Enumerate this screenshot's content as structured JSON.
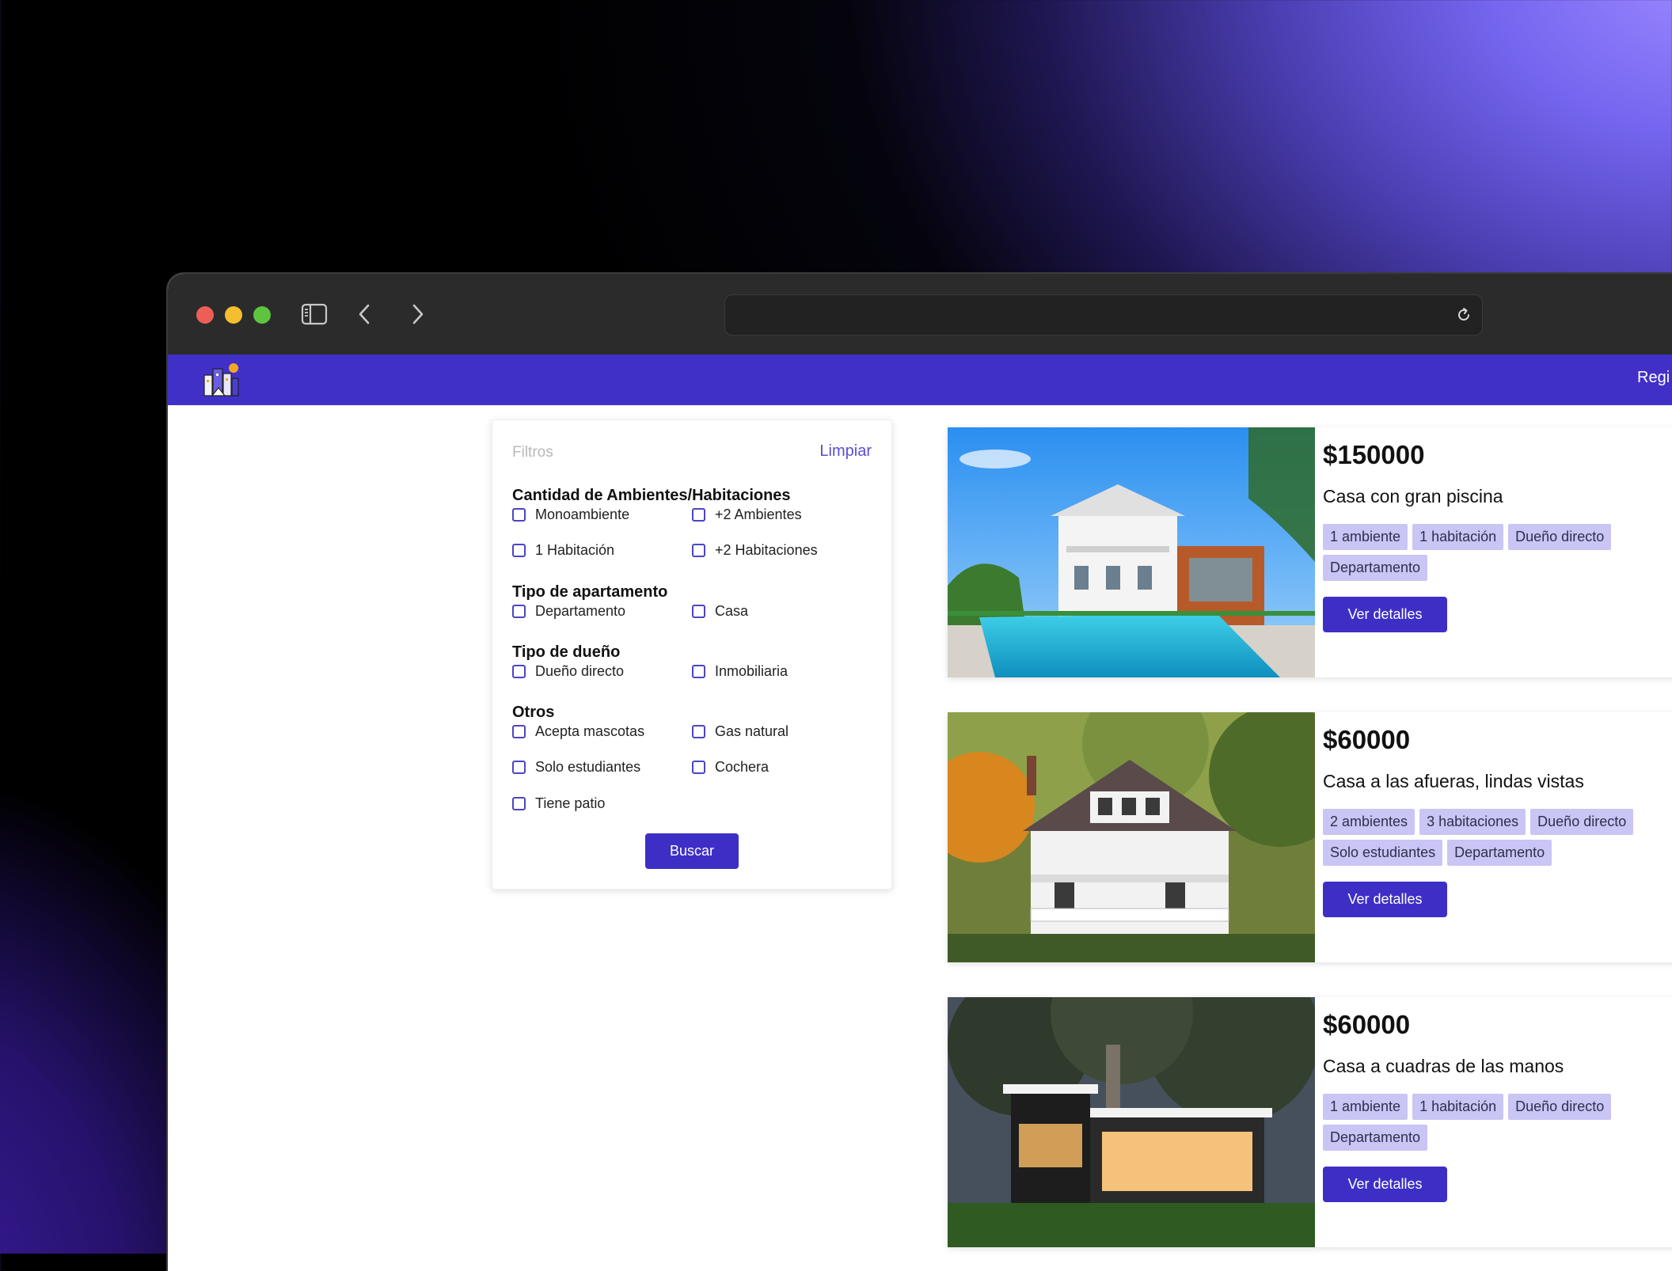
{
  "browser": {
    "address_value": ""
  },
  "header": {
    "register_label": "Regi"
  },
  "filters": {
    "title": "Filtros",
    "clear_label": "Limpiar",
    "sections": [
      {
        "title": "Cantidad de Ambientes/Habitaciones",
        "options": [
          "Monoambiente",
          "+2 Ambientes",
          "1 Habitación",
          "+2 Habitaciones"
        ]
      },
      {
        "title": "Tipo de apartamento",
        "options": [
          "Departamento",
          "Casa"
        ]
      },
      {
        "title": "Tipo de dueño",
        "options": [
          "Dueño directo",
          "Inmobiliaria"
        ]
      },
      {
        "title": "Otros",
        "options": [
          "Acepta mascotas",
          "Gas natural",
          "Solo estudiantes",
          "Cochera",
          "Tiene patio"
        ]
      }
    ],
    "search_label": "Buscar"
  },
  "listings": [
    {
      "price": "$150000",
      "title": "Casa con gran piscina",
      "tags": [
        "1 ambiente",
        "1 habitación",
        "Dueño directo",
        "Departamento"
      ],
      "details_label": "Ver detalles"
    },
    {
      "price": "$60000",
      "title": "Casa a las afueras, lindas vistas",
      "tags": [
        "2 ambientes",
        "3 habitaciones",
        "Dueño directo",
        "Solo estudiantes",
        "Departamento"
      ],
      "details_label": "Ver detalles"
    },
    {
      "price": "$60000",
      "title": "Casa a cuadras de las manos",
      "tags": [
        "1 ambiente",
        "1 habitación",
        "Dueño directo",
        "Departamento"
      ],
      "details_label": "Ver detalles"
    }
  ],
  "colors": {
    "primary": "#3d2fc6",
    "navbar": "#4030c8",
    "tag_bg": "#c9c5f4",
    "link": "#5a4ed4"
  },
  "icons": [
    "sidebar-toggle-icon",
    "back-arrow-icon",
    "forward-arrow-icon",
    "reload-icon",
    "app-logo",
    "heart-icon"
  ]
}
